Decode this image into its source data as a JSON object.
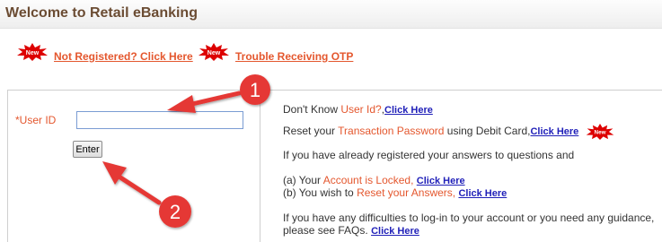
{
  "header": {
    "title": "Welcome to Retail eBanking"
  },
  "notices": {
    "badge_text": "New",
    "not_registered": "Not Registered? Click Here",
    "trouble_otp": "Trouble Receiving OTP"
  },
  "login": {
    "required_mark": "*",
    "userid_label": "User ID",
    "userid_value": "",
    "enter_label": "Enter"
  },
  "help": {
    "line1_prefix": "Don't Know ",
    "line1_highlight": "User Id?",
    "line1_sep": ",",
    "line1_link": "Click Here",
    "line2_prefix": "Reset your ",
    "line2_highlight": "Transaction Password",
    "line2_suffix": " using Debit Card,",
    "line2_link": "Click Here",
    "line3": "If you have already registered your answers to questions and",
    "line4_prefix": "(a) Your ",
    "line4_highlight": "Account is Locked,",
    "line4_link": "Click Here",
    "line5_prefix": "(b) You wish to ",
    "line5_highlight": "Reset your Answers,",
    "line5_link": "Click Here",
    "line6": "If you have any difficulties to log-in to your account or you need any guidance,",
    "line7_prefix": "please see FAQs. ",
    "line7_link": "Click Here"
  },
  "annotations": {
    "callout1": "1",
    "callout2": "2"
  },
  "colors": {
    "accent_orange": "#e4572e",
    "link_blue": "#1f1fb8",
    "badge_red": "#dd0000",
    "callout_red": "#e53935",
    "header_text": "#6b4c33"
  }
}
